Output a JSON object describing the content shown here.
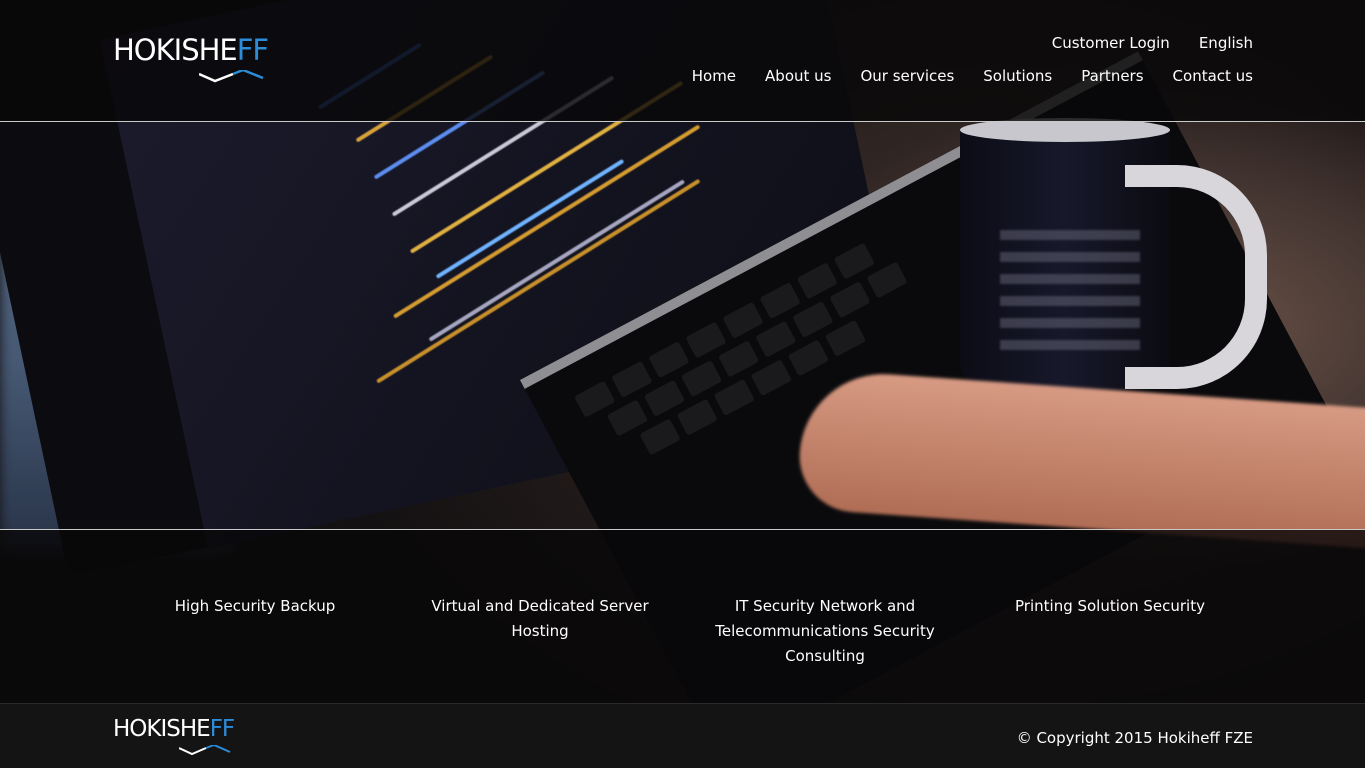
{
  "header": {
    "logo": {
      "part1": "HOKISHE",
      "part2": "FF"
    },
    "top_links": [
      {
        "label": "Customer Login"
      },
      {
        "label": "English"
      }
    ],
    "nav": [
      {
        "label": "Home"
      },
      {
        "label": "About us"
      },
      {
        "label": "Our services"
      },
      {
        "label": "Solutions"
      },
      {
        "label": "Partners"
      },
      {
        "label": "Contact us"
      }
    ]
  },
  "services": [
    {
      "label": "High Security Backup"
    },
    {
      "label": "Virtual and Dedicated Server Hosting"
    },
    {
      "label": "IT Security Network and Telecommunications Security Consulting"
    },
    {
      "label": "Printing Solution Security"
    }
  ],
  "footer": {
    "logo": {
      "part1": "HOKISHE",
      "part2": "FF"
    },
    "copyright": "© Copyright 2015 Hokiheff FZE"
  },
  "colors": {
    "accent": "#2d8cd8",
    "footer_bg": "#141414"
  }
}
